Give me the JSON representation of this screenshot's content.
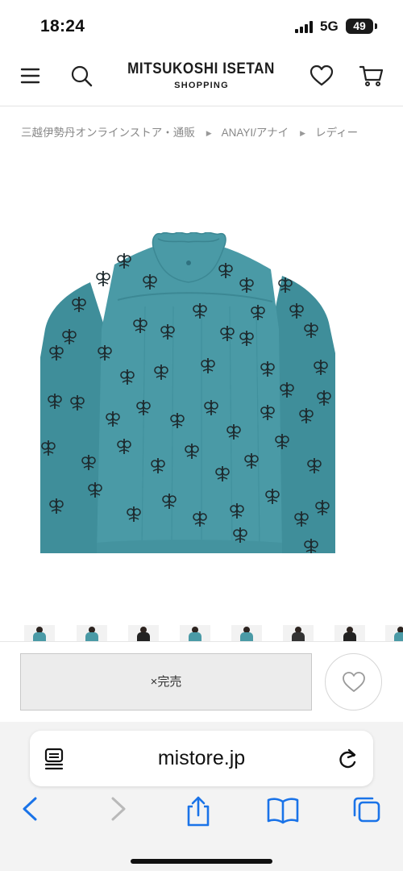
{
  "status_bar": {
    "time": "18:24",
    "network": "5G",
    "battery": "49"
  },
  "header": {
    "logo_main": "MITSUKOSHI ISETAN",
    "logo_sub": "SHOPPING",
    "icons": [
      "menu-icon",
      "search-icon",
      "heart-icon",
      "cart-icon"
    ]
  },
  "breadcrumb": {
    "items": [
      "三越伊勢丹オンラインストア・通販",
      "ANAYI/アナイ",
      "レディー"
    ]
  },
  "product": {
    "image": "teal-printed-ruffle-collar-blouse",
    "colors": {
      "fabric": "#4a9aa6",
      "print": "#1e2a2e"
    }
  },
  "thumbnails": {
    "count": 8
  },
  "purchase": {
    "soldout_label": "×完売",
    "favorite_icon": "heart-icon"
  },
  "browser": {
    "url": "mistore.jp",
    "icons": [
      "reader-icon",
      "reload-icon",
      "back-icon",
      "forward-icon",
      "share-icon",
      "bookmarks-icon",
      "tabs-icon"
    ],
    "accent_color": "#1a73e8"
  }
}
